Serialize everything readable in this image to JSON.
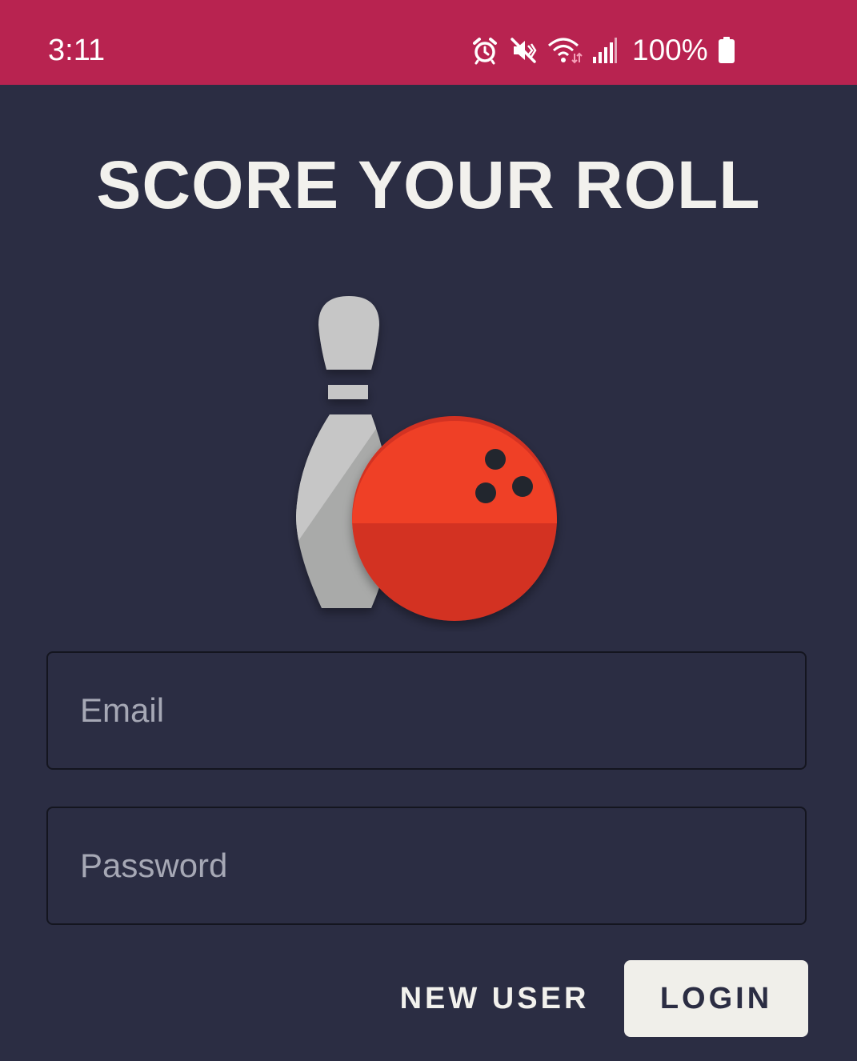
{
  "status_bar": {
    "time": "3:11",
    "battery": "100%",
    "icons": [
      "alarm-icon",
      "vibrate-mute-icon",
      "wifi-icon",
      "signal-icon",
      "battery-icon"
    ],
    "background_color": "#b82350"
  },
  "title": "SCORE YOUR ROLL",
  "logo": {
    "icons": [
      "bowling-pin-icon",
      "bowling-ball-icon"
    ],
    "ball_color": "#ef4026",
    "pin_color": "#c6c6c6"
  },
  "form": {
    "email": {
      "placeholder": "Email",
      "value": ""
    },
    "password": {
      "placeholder": "Password",
      "value": ""
    }
  },
  "buttons": {
    "new_user": "NEW USER",
    "login": "LOGIN"
  },
  "colors": {
    "background": "#2b2d43",
    "title_text": "#f2f1ed",
    "login_button": "#f0efea"
  }
}
